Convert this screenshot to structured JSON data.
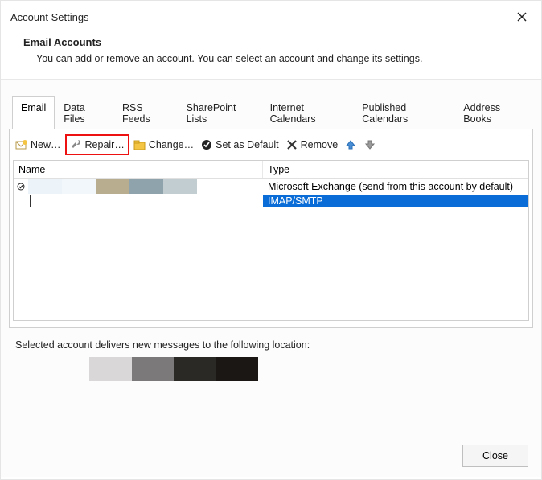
{
  "window": {
    "title": "Account Settings"
  },
  "header": {
    "title": "Email Accounts",
    "description": "You can add or remove an account. You can select an account and change its settings."
  },
  "tabs": [
    {
      "label": "Email",
      "active": true
    },
    {
      "label": "Data Files",
      "active": false
    },
    {
      "label": "RSS Feeds",
      "active": false
    },
    {
      "label": "SharePoint Lists",
      "active": false
    },
    {
      "label": "Internet Calendars",
      "active": false
    },
    {
      "label": "Published Calendars",
      "active": false
    },
    {
      "label": "Address Books",
      "active": false
    }
  ],
  "toolbar": {
    "new": "New…",
    "repair": "Repair…",
    "change": "Change…",
    "set_default": "Set as Default",
    "remove": "Remove"
  },
  "list": {
    "columns": {
      "name": "Name",
      "type": "Type"
    },
    "rows": [
      {
        "default": true,
        "type": "Microsoft Exchange (send from this account by default)",
        "selected": false,
        "swatches": [
          "#ecf4fa",
          "#f1f7fa",
          "#b8ad8f",
          "#8fa3ac",
          "#c2cdd1"
        ]
      },
      {
        "default": false,
        "type": "IMAP/SMTP",
        "selected": true
      }
    ]
  },
  "delivery": {
    "message": "Selected account delivers new messages to the following location:",
    "swatches": [
      "#d9d7d8",
      "#7b7979",
      "#2b2926",
      "#1b1714"
    ]
  },
  "footer": {
    "close": "Close"
  }
}
